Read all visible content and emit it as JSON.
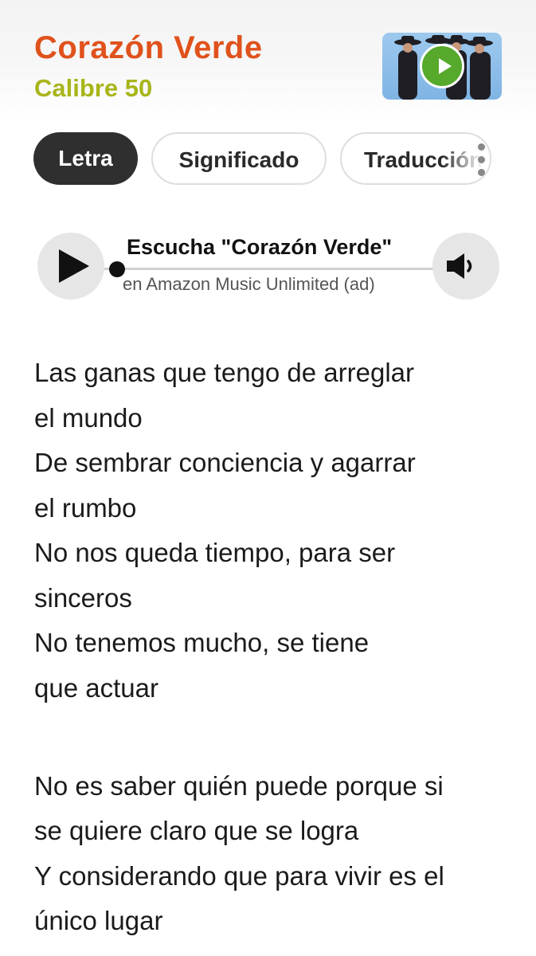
{
  "header": {
    "song_title": "Corazón Verde",
    "artist": "Calibre 50",
    "title_color": "#e0521c",
    "artist_color": "#a8b51a",
    "thumbnail_icon": "play-icon"
  },
  "tabs": [
    {
      "label": "Letra",
      "active": true
    },
    {
      "label": "Significado",
      "active": false
    },
    {
      "label": "Traducción",
      "active": false
    }
  ],
  "player": {
    "title": "Escucha \"Corazón Verde\"",
    "subtitle": "en Amazon Music Unlimited (ad)",
    "progress": 0,
    "play_icon": "play-icon",
    "volume_icon": "speaker-icon"
  },
  "lyrics": {
    "stanza1": [
      "Las ganas que tengo de arreglar",
      "el mundo",
      "De sembrar conciencia y agarrar",
      "el rumbo",
      "No nos queda tiempo, para ser",
      "sinceros",
      "No tenemos mucho, se tiene",
      "que actuar"
    ],
    "stanza2": [
      "No es saber quién puede porque si",
      "se quiere claro que se logra",
      "Y considerando que para vivir es el",
      "único lugar"
    ]
  }
}
